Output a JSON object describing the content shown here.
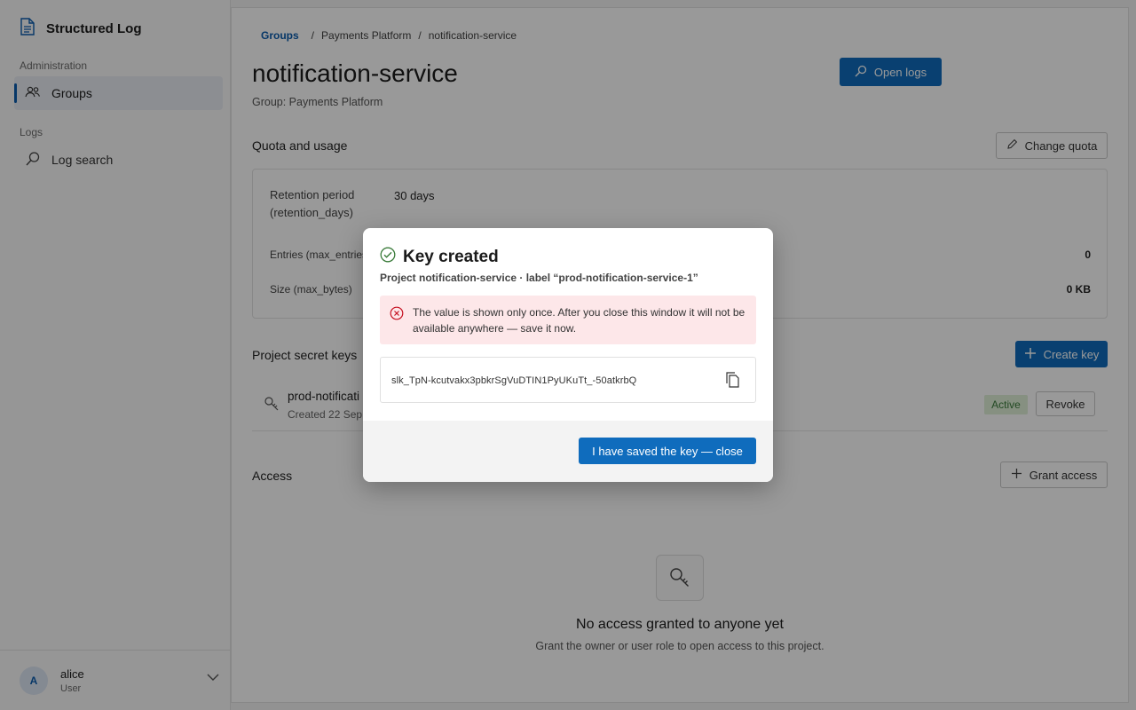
{
  "app": {
    "title": "Structured Log"
  },
  "sidebar": {
    "sections": [
      {
        "label": "Administration",
        "items": [
          {
            "label": "Groups",
            "icon": "users-icon",
            "active": true
          }
        ]
      },
      {
        "label": "Logs",
        "items": [
          {
            "label": "Log search",
            "icon": "search-icon",
            "active": false
          }
        ]
      }
    ],
    "user": {
      "initial": "A",
      "name": "alice",
      "role": "User"
    }
  },
  "breadcrumb": {
    "root": "Groups",
    "sep1": "/",
    "group": "Payments Platform",
    "sep2": "/",
    "current": "notification-service"
  },
  "page": {
    "title": "notification-service",
    "subtitle": "Group: Payments Platform",
    "open_logs_label": "Open logs"
  },
  "quota": {
    "heading": "Quota and usage",
    "change_label": "Change quota",
    "rows": [
      {
        "label_line1": "Retention period",
        "label_line2": "(retention_days)",
        "value": "30 days"
      },
      {
        "label": "Entries (max_entries",
        "right": "0"
      },
      {
        "label": "Size (max_bytes)",
        "right": "0 KB"
      }
    ]
  },
  "keys": {
    "heading": "Project secret keys",
    "create_label": "Create key",
    "rows": [
      {
        "name": "prod-notificati",
        "created": "Created 22 Sep",
        "status": "Active",
        "revoke_label": "Revoke"
      }
    ]
  },
  "access": {
    "heading": "Access",
    "grant_label": "Grant access",
    "empty_title": "No access granted to anyone yet",
    "empty_sub": "Grant the owner or user role to open access to this project."
  },
  "dialog": {
    "title": "Key created",
    "subtitle": "Project notification-service · label “prod-notification-service-1”",
    "warning": "The value is shown only once. After you close this window it will not be available anywhere — save it now.",
    "key_value": "slk_TpN-kcutvakx3pbkrSgVuDTIN1PyUKuTt_-50atkrbQ",
    "close_label": "I have saved the key — close"
  },
  "colors": {
    "accent": "#0f6cbd",
    "success": "#3a7b3a",
    "danger": "#c50f1f",
    "danger_bg": "#fde7e9"
  }
}
